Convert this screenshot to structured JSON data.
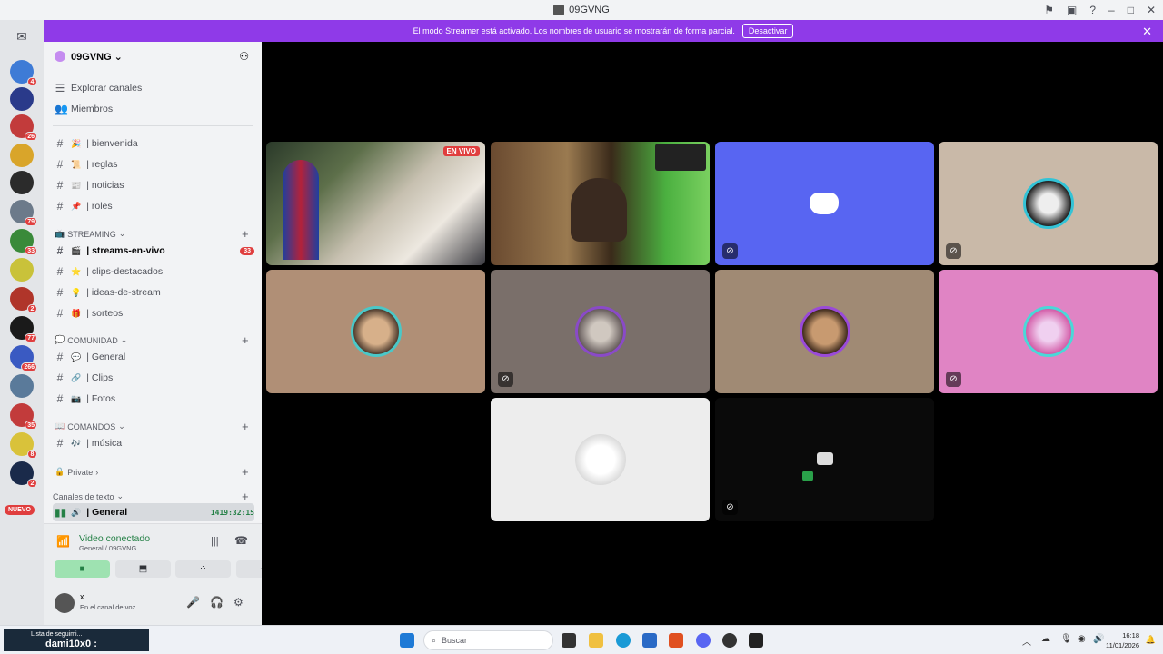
{
  "window": {
    "title": "09GVNG"
  },
  "banner": {
    "text": "El modo Streamer está activado. Los nombres de usuario se mostrarán de forma parcial.",
    "button": "Desactivar",
    "close": "✕"
  },
  "servers": [
    {
      "badge": "4",
      "color": "#3e7bd6"
    },
    {
      "badge": "",
      "color": "#2a3a8a"
    },
    {
      "badge": "26",
      "color": "#c23b3b"
    },
    {
      "badge": "",
      "color": "#d9a52a"
    },
    {
      "badge": "",
      "color": "#2b2b2b"
    },
    {
      "badge": "79",
      "color": "#6c7a8a"
    },
    {
      "badge": "33",
      "color": "#3a8a3a"
    },
    {
      "badge": "",
      "color": "#c9c23a"
    },
    {
      "badge": "2",
      "color": "#b0352a"
    },
    {
      "badge": "77",
      "color": "#1a1a1a"
    },
    {
      "badge": "266",
      "color": "#3a5ac2"
    },
    {
      "badge": "",
      "color": "#5a7a9a"
    },
    {
      "badge": "35",
      "color": "#c23b3b"
    },
    {
      "badge": "8",
      "color": "#d9c23a"
    },
    {
      "badge": "2",
      "color": "#1a2a4a"
    }
  ],
  "rail": {
    "new_label": "NUEVO"
  },
  "guild": {
    "name": "09GVNG ⌄"
  },
  "sidebar": {
    "explore": "Explorar canales",
    "members": "Miembros",
    "channels_top": [
      {
        "emoji": "🎉",
        "name": "| bienvenida"
      },
      {
        "emoji": "📜",
        "name": "| reglas"
      },
      {
        "emoji": "📰",
        "name": "| noticias"
      },
      {
        "emoji": "📌",
        "name": "| roles"
      }
    ],
    "cat_streaming": "STREAMING",
    "channels_streaming": [
      {
        "emoji": "🎬",
        "name": "| streams-en-vivo",
        "badge": "33"
      },
      {
        "emoji": "⭐",
        "name": "| clips-destacados"
      },
      {
        "emoji": "💡",
        "name": "| ideas-de-stream"
      },
      {
        "emoji": "🎁",
        "name": "| sorteos"
      }
    ],
    "cat_comunidad": "COMUNIDAD",
    "channels_comunidad": [
      {
        "emoji": "💬",
        "name": "| General"
      },
      {
        "emoji": "🔗",
        "name": "| Clips"
      },
      {
        "emoji": "📷",
        "name": "| Fotos"
      }
    ],
    "cat_comandos": "COMANDOS",
    "channels_comandos": [
      {
        "emoji": "🎶",
        "name": "| música"
      }
    ],
    "cat_private": "Private",
    "cat_text": "Canales de texto",
    "voice_channel": {
      "name": "| General",
      "time": "1419:32:15"
    }
  },
  "voice_panel": {
    "title": "Video conectado",
    "subtitle": "General / 09GVNG"
  },
  "user": {
    "name": "x...",
    "status": "En el canal de voz"
  },
  "stage": {
    "live_label": "EN VIVO"
  },
  "taskbar": {
    "search": "Buscar",
    "time": "16:18",
    "date": "11/01/2026",
    "left_text": "Lista de seguimi...",
    "left_name": "dami10x0 :"
  }
}
